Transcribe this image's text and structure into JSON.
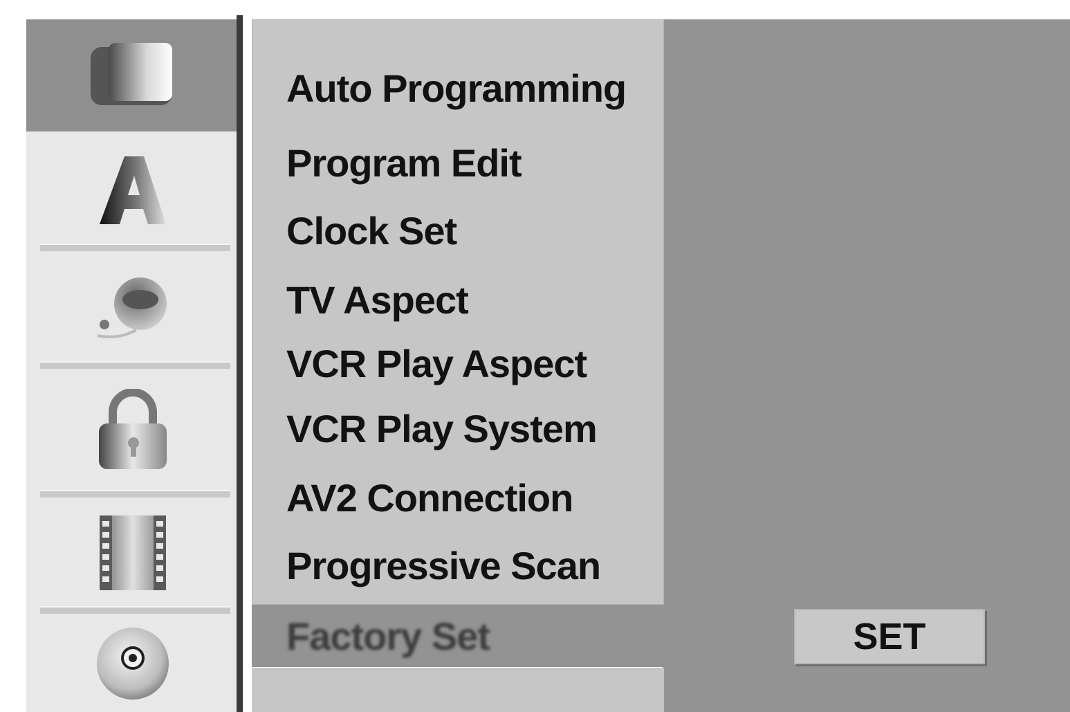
{
  "categories": [
    {
      "icon": "tv-icon",
      "selected": true
    },
    {
      "icon": "letter-a-icon",
      "selected": false
    },
    {
      "icon": "speaker-icon",
      "selected": false
    },
    {
      "icon": "lock-icon",
      "selected": false
    },
    {
      "icon": "film-icon",
      "selected": false
    },
    {
      "icon": "disc-icon",
      "selected": false
    }
  ],
  "menu": {
    "items": [
      "Auto Programming",
      "Program Edit",
      "Clock Set",
      "TV Aspect",
      "VCR Play Aspect",
      "VCR Play System",
      "AV2 Connection",
      "Progressive Scan",
      "Factory Set"
    ],
    "active_item": "Factory Set"
  },
  "action": {
    "set_label": "SET"
  },
  "colors": {
    "selected_category": "#8f8f8f",
    "menu_panel": "#c6c6c6",
    "value_area": "#939393",
    "text": "#121212"
  }
}
